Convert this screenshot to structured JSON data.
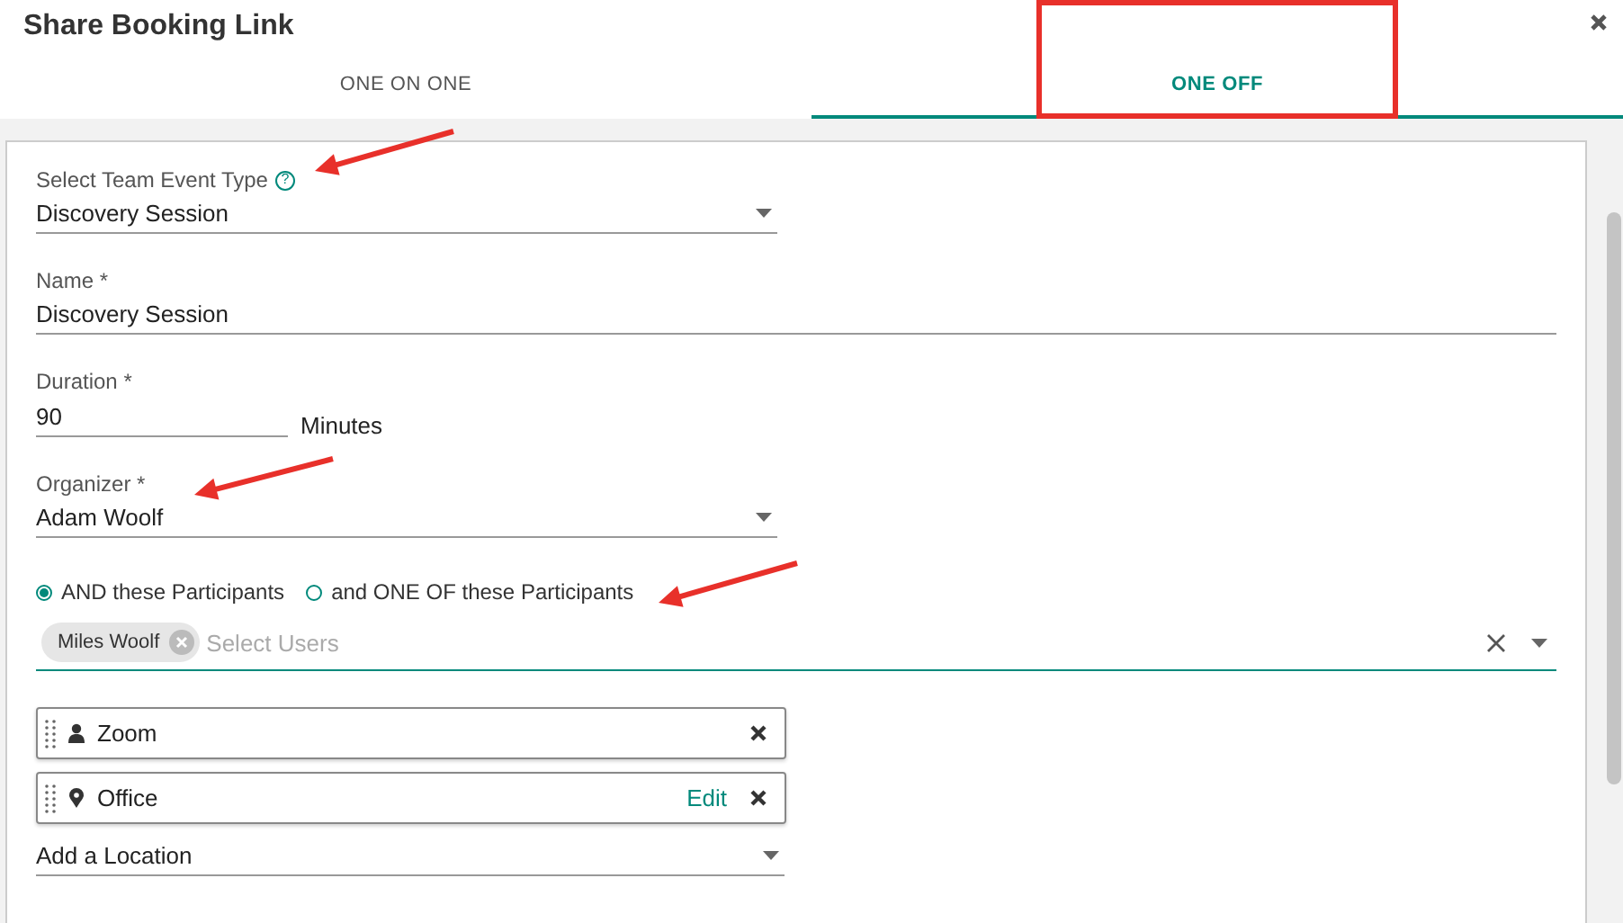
{
  "dialog": {
    "title": "Share Booking Link"
  },
  "tabs": [
    {
      "label": "ONE ON ONE",
      "selected": false
    },
    {
      "label": "ONE OFF",
      "selected": true
    }
  ],
  "event_type": {
    "label": "Select Team Event Type",
    "help": "?",
    "value": "Discovery Session"
  },
  "name": {
    "label": "Name *",
    "value": "Discovery Session"
  },
  "duration": {
    "label": "Duration *",
    "value": "90",
    "unit": "Minutes"
  },
  "organizer": {
    "label": "Organizer *",
    "value": "Adam Woolf"
  },
  "participant_modes": [
    {
      "label": "AND these Participants",
      "selected": true
    },
    {
      "label": "and ONE OF these Participants",
      "selected": false
    }
  ],
  "users": {
    "tags": [
      "Miles Woolf"
    ],
    "placeholder": "Select Users"
  },
  "locations": [
    {
      "kind": "user",
      "name": "Zoom"
    },
    {
      "kind": "place",
      "name": "Office",
      "action": "Edit"
    }
  ],
  "add_location": {
    "value": "Add a Location"
  }
}
